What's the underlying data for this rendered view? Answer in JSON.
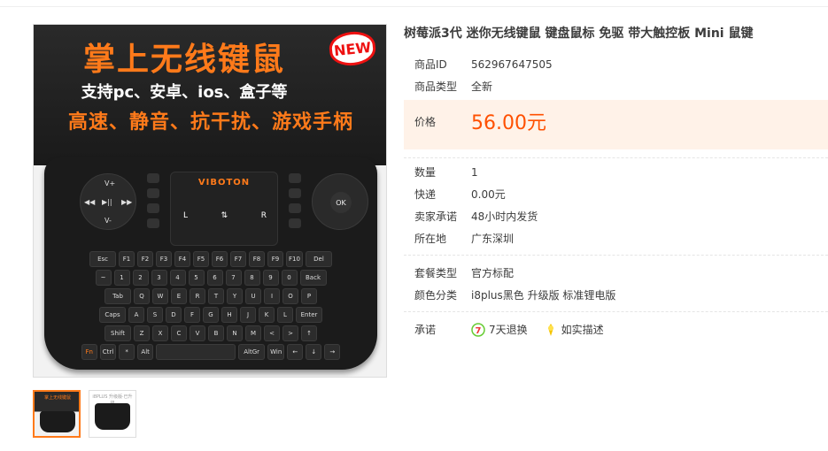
{
  "product": {
    "title": "树莓派3代 迷你无线键鼠 键盘鼠标 免驱 带大触控板 Mini 鼠键",
    "image": {
      "banner_title": "掌上无线键鼠",
      "banner_sub1": "支持pc、安卓、ios、盒子等",
      "banner_sub2": "高速、静音、抗干扰、游戏手柄",
      "badge": "NEW",
      "brand": "VIBOTON",
      "touch_l": "L",
      "touch_mid": "⇅",
      "touch_r": "R",
      "ok": "OK",
      "media_vplus": "V+",
      "media_vminus": "V-",
      "media_prev": "◀◀",
      "media_play": "▶||",
      "media_next": "▶▶"
    },
    "thumbnails": [
      {
        "caption": "掌上无线键鼠",
        "active": true
      },
      {
        "caption": "i8PLUS 升级版·已升级",
        "active": false
      }
    ]
  },
  "keyboard_rows": [
    [
      "Esc",
      "F1",
      "F2",
      "F3",
      "F4",
      "F5",
      "F6",
      "F7",
      "F8",
      "F9",
      "F10",
      "Del"
    ],
    [
      "~",
      "1",
      "2",
      "3",
      "4",
      "5",
      "6",
      "7",
      "8",
      "9",
      "0",
      "Back"
    ],
    [
      "Tab",
      "Q",
      "W",
      "E",
      "R",
      "T",
      "Y",
      "U",
      "I",
      "O",
      "P"
    ],
    [
      "Caps",
      "A",
      "S",
      "D",
      "F",
      "G",
      "H",
      "J",
      "K",
      "L",
      "Enter"
    ],
    [
      "Shift",
      "Z",
      "X",
      "C",
      "V",
      "B",
      "N",
      "M",
      "<",
      ">",
      "↑"
    ],
    [
      "Fn",
      "Ctrl",
      "*",
      "Alt",
      "",
      "AltGr",
      "Win",
      "←",
      "↓",
      "→"
    ]
  ],
  "fields": {
    "id_label": "商品ID",
    "id_value": "562967647505",
    "type_label": "商品类型",
    "type_value": "全新",
    "price_label": "价格",
    "price_value": "56.00元",
    "qty_label": "数量",
    "qty_value": "1",
    "ship_label": "快递",
    "ship_value": "0.00元",
    "promise_label": "卖家承诺",
    "promise_value": "48小时内发货",
    "loc_label": "所在地",
    "loc_value": "广东深圳",
    "package_label": "套餐类型",
    "package_value": "官方标配",
    "color_label": "颜色分类",
    "color_value": "i8plus黑色 升级版 标准锂电版",
    "guarantee_label": "承诺",
    "guarantee_items": [
      {
        "label": "7天退换",
        "icon": "seven-day-return-icon"
      },
      {
        "label": "如实描述",
        "icon": "as-described-icon"
      }
    ]
  },
  "colors": {
    "price": "#ff5000",
    "price_bg": "#fff2e8",
    "accent": "#ff7a1a"
  }
}
